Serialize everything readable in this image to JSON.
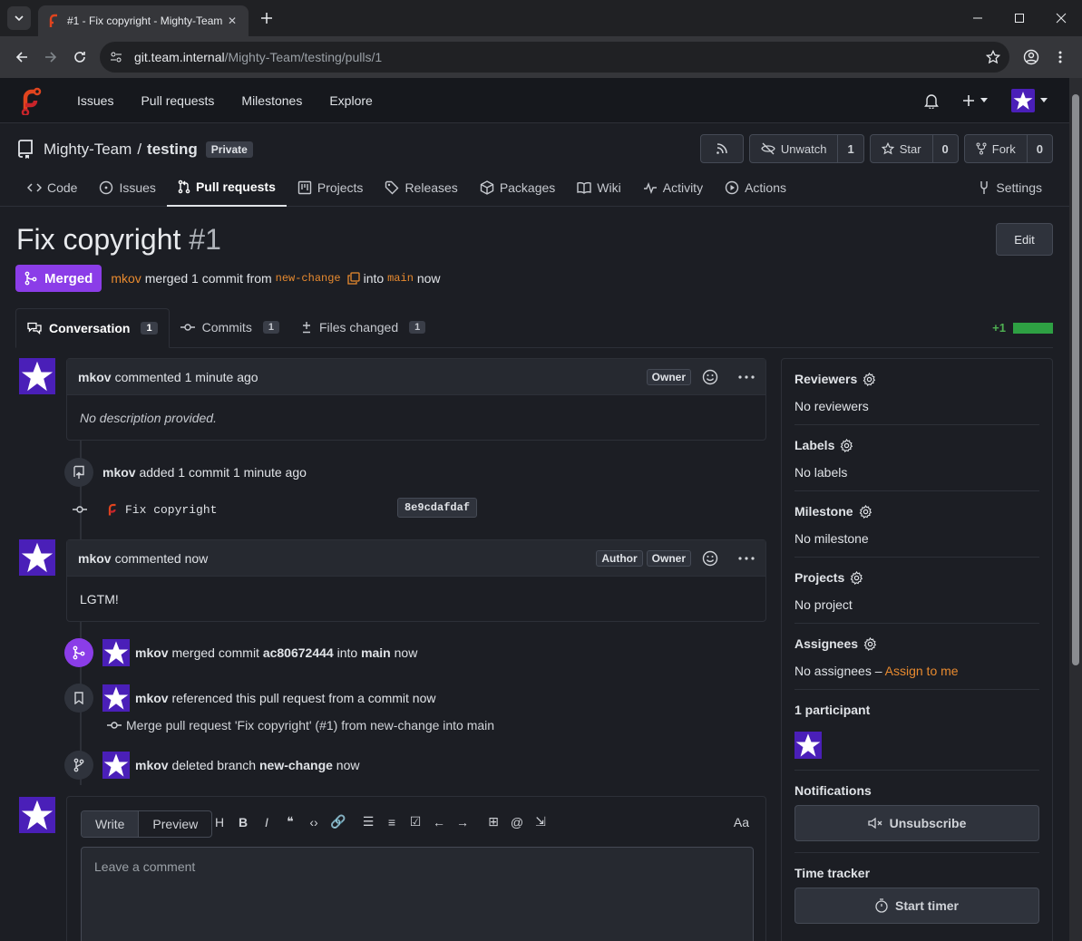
{
  "browser": {
    "tab_title": "#1 - Fix copyright - Mighty-Team",
    "url_host": "git.team.internal",
    "url_path": "/Mighty-Team/testing/pulls/1"
  },
  "nav": {
    "issues": "Issues",
    "pulls": "Pull requests",
    "milestones": "Milestones",
    "explore": "Explore"
  },
  "repo": {
    "owner": "Mighty-Team",
    "separator": "/",
    "name": "testing",
    "visibility": "Private",
    "unwatch_label": "Unwatch",
    "watch_count": "1",
    "star_label": "Star",
    "star_count": "0",
    "fork_label": "Fork",
    "fork_count": "0"
  },
  "repo_tabs": {
    "code": "Code",
    "issues": "Issues",
    "pulls": "Pull requests",
    "projects": "Projects",
    "releases": "Releases",
    "packages": "Packages",
    "wiki": "Wiki",
    "activity": "Activity",
    "actions": "Actions",
    "settings": "Settings"
  },
  "pr": {
    "title": "Fix copyright",
    "number": "#1",
    "edit_label": "Edit",
    "status": "Merged",
    "author": "mkov",
    "summary_pre": "merged 1 commit from",
    "head_branch": "new-change",
    "into_word": "into",
    "base_branch": "main",
    "when": "now"
  },
  "pr_tabs": {
    "conversation": "Conversation",
    "conversation_count": "1",
    "commits": "Commits",
    "commits_count": "1",
    "files": "Files changed",
    "files_count": "1",
    "additions": "+1"
  },
  "timeline": {
    "c1_author": "mkov",
    "c1_meta": "commented 1 minute ago",
    "c1_role": "Owner",
    "c1_body": "No description provided.",
    "push_author": "mkov",
    "push_meta": "added 1 commit 1 minute ago",
    "commit_msg": "Fix copyright",
    "commit_sha": "8e9cdafdaf",
    "c2_author": "mkov",
    "c2_meta": "commented now",
    "c2_role1": "Author",
    "c2_role2": "Owner",
    "c2_body": "LGTM!",
    "merge_author": "mkov",
    "merge_pre": "merged commit",
    "merge_sha": "ac80672444",
    "merge_into": "into",
    "merge_branch": "main",
    "merge_when": "now",
    "ref_author": "mkov",
    "ref_text": "referenced this pull request from a commit now",
    "ref_commit": "Merge pull request 'Fix copyright' (#1) from new-change into main",
    "del_author": "mkov",
    "del_pre": "deleted branch",
    "del_branch": "new-change",
    "del_when": "now"
  },
  "editor": {
    "write": "Write",
    "preview": "Preview",
    "aa": "Aa",
    "placeholder": "Leave a comment"
  },
  "sidebar": {
    "reviewers": "Reviewers",
    "reviewers_val": "No reviewers",
    "labels": "Labels",
    "labels_val": "No labels",
    "milestone": "Milestone",
    "milestone_val": "No milestone",
    "projects": "Projects",
    "projects_val": "No project",
    "assignees": "Assignees",
    "assignees_val": "No assignees –",
    "assign_me": "Assign to me",
    "participants": "1 participant",
    "notifications": "Notifications",
    "unsubscribe": "Unsubscribe",
    "time_tracker": "Time tracker",
    "start_timer": "Start timer"
  },
  "colors": {
    "accent": "#e88a2f",
    "merged": "#8b3de8",
    "avatar": "#4a1fb8"
  }
}
